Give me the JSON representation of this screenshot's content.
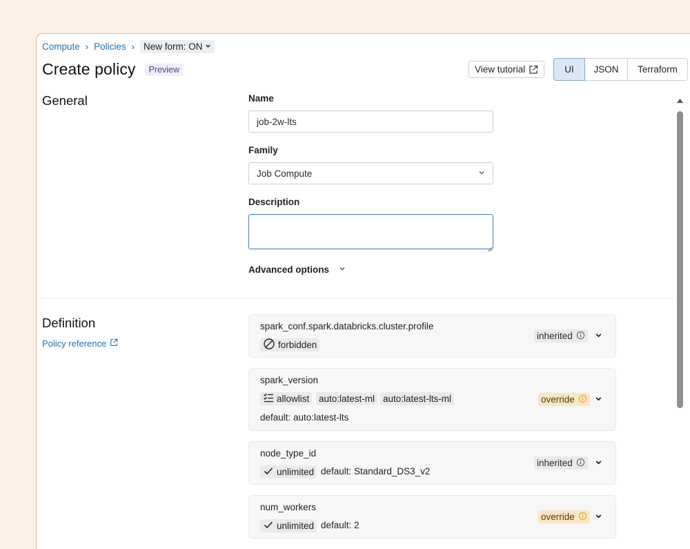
{
  "breadcrumb": {
    "compute": "Compute",
    "policies": "Policies",
    "separator": "›",
    "form_toggle": "New form: ON",
    "form_toggle_chevron": "⌄"
  },
  "header": {
    "title": "Create policy",
    "badge": "Preview",
    "tutorial_label": "View tutorial",
    "tabs": [
      "UI",
      "JSON",
      "Terraform"
    ],
    "active_tab": "UI"
  },
  "general": {
    "title": "General",
    "name_label": "Name",
    "name_value": "job-2w-lts",
    "family_label": "Family",
    "family_value": "Job Compute",
    "description_label": "Description",
    "description_value": "",
    "advanced_label": "Advanced options"
  },
  "definition": {
    "title": "Definition",
    "policy_reference": "Policy reference",
    "rules": [
      {
        "name": "spark_conf.spark.databricks.cluster.profile",
        "type_label": "forbidden",
        "type_icon": "forbidden-icon",
        "status": "inherited"
      },
      {
        "name": "spark_version",
        "type_label": "allowlist",
        "type_icon": "allowlist-icon",
        "values": [
          "auto:latest-ml",
          "auto:latest-lts-ml"
        ],
        "default": "default: auto:latest-lts",
        "status": "override"
      },
      {
        "name": "node_type_id",
        "type_label": "unlimited",
        "type_icon": "check-icon",
        "default": "default: Standard_DS3_v2",
        "status": "inherited"
      },
      {
        "name": "num_workers",
        "type_label": "unlimited",
        "type_icon": "check-icon",
        "default": "default: 2",
        "status": "override"
      }
    ]
  },
  "colors": {
    "accent": "#2272b4",
    "override_bg": "#fbe6c3",
    "inherited_bg": "#eaeaea",
    "page_bg": "#fdf1e7"
  }
}
